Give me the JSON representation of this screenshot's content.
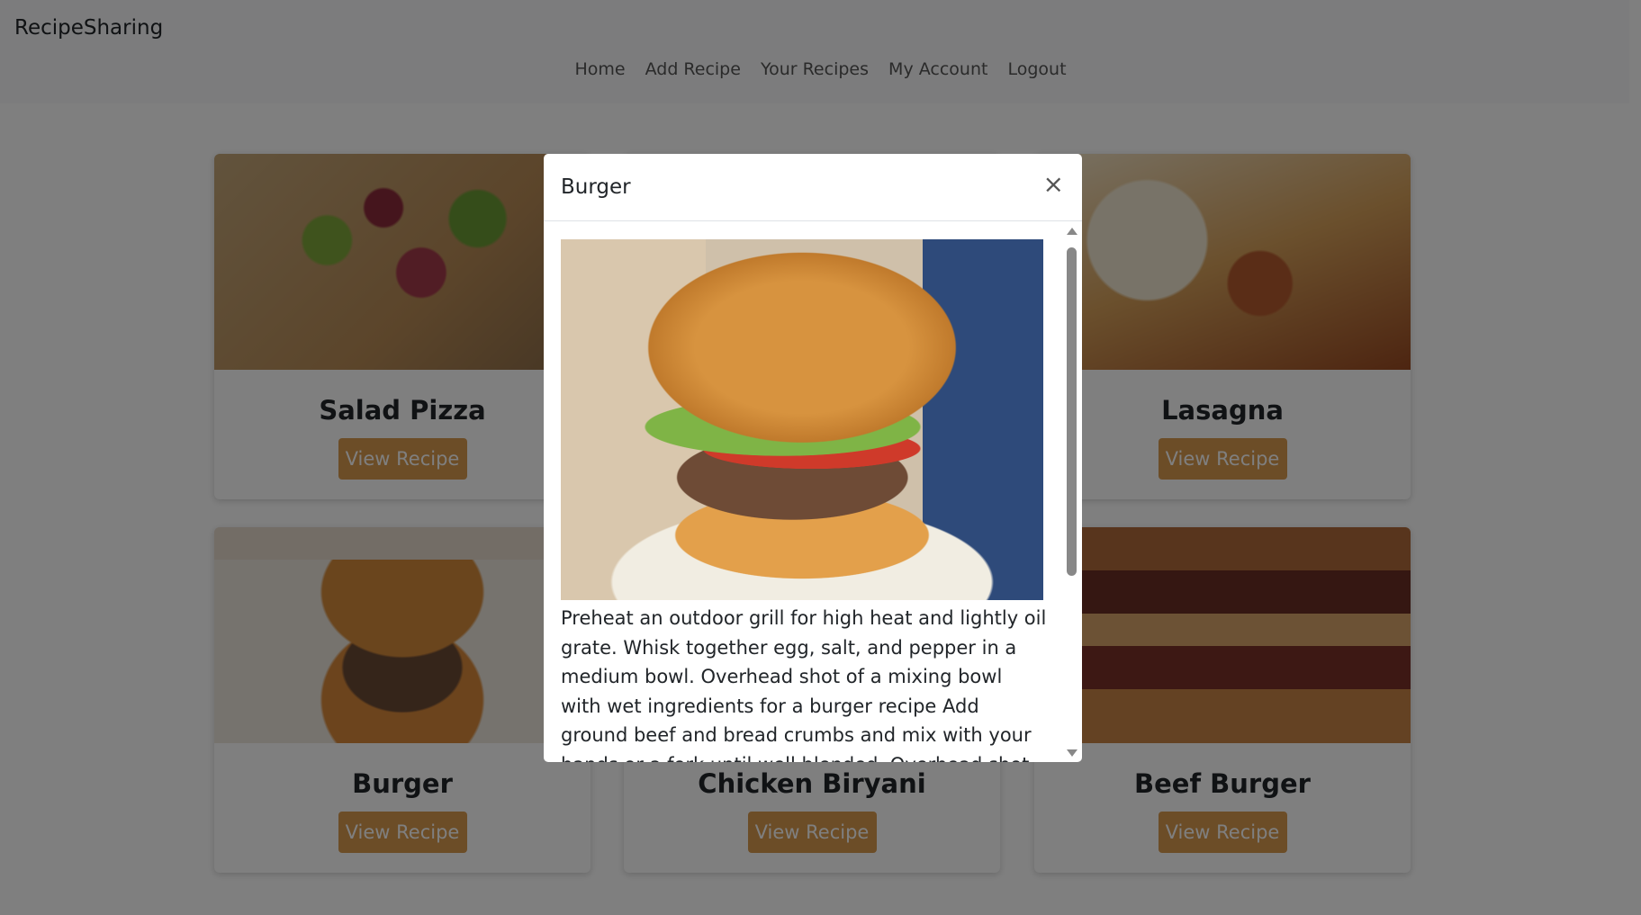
{
  "app": {
    "brand": "RecipeSharing"
  },
  "nav": {
    "items": [
      "Home",
      "Add Recipe",
      "Your Recipes",
      "My Account",
      "Logout"
    ]
  },
  "cards": [
    {
      "title": "Salad Pizza",
      "button": "View Recipe"
    },
    {
      "title": "Lasagna",
      "button": "View Recipe"
    },
    {
      "title": "Burger",
      "button": "View Recipe"
    },
    {
      "title": "Chicken Biryani",
      "button": "View Recipe"
    },
    {
      "title": "Beef Burger",
      "button": "View Recipe"
    }
  ],
  "modal": {
    "title": "Burger",
    "close": "×",
    "text": "Preheat an outdoor grill for high heat and lightly oil grate. Whisk together egg, salt, and pepper in a medium bowl. Overhead shot of a mixing bowl with wet ingredients for a burger recipe Add ground beef and bread crumbs and mix with your hands or a fork until well blended. Overhead shot of ground meat being"
  },
  "colors": {
    "accent": "#d99a4e",
    "overlay": "rgba(0,0,0,0.5)"
  }
}
